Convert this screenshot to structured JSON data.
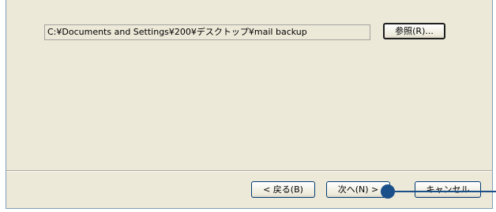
{
  "folder_path": {
    "value": "C:¥Documents and Settings¥200¥デスクトップ¥mail backup"
  },
  "browse_button": {
    "label": "参照(R)..."
  },
  "nav": {
    "back_label": "< 戻る(B)",
    "next_label": "次へ(N) >",
    "cancel_label": "キャンセル"
  },
  "colors": {
    "dialog_bg": "#ece9d8",
    "callout": "#1b4f8a"
  }
}
